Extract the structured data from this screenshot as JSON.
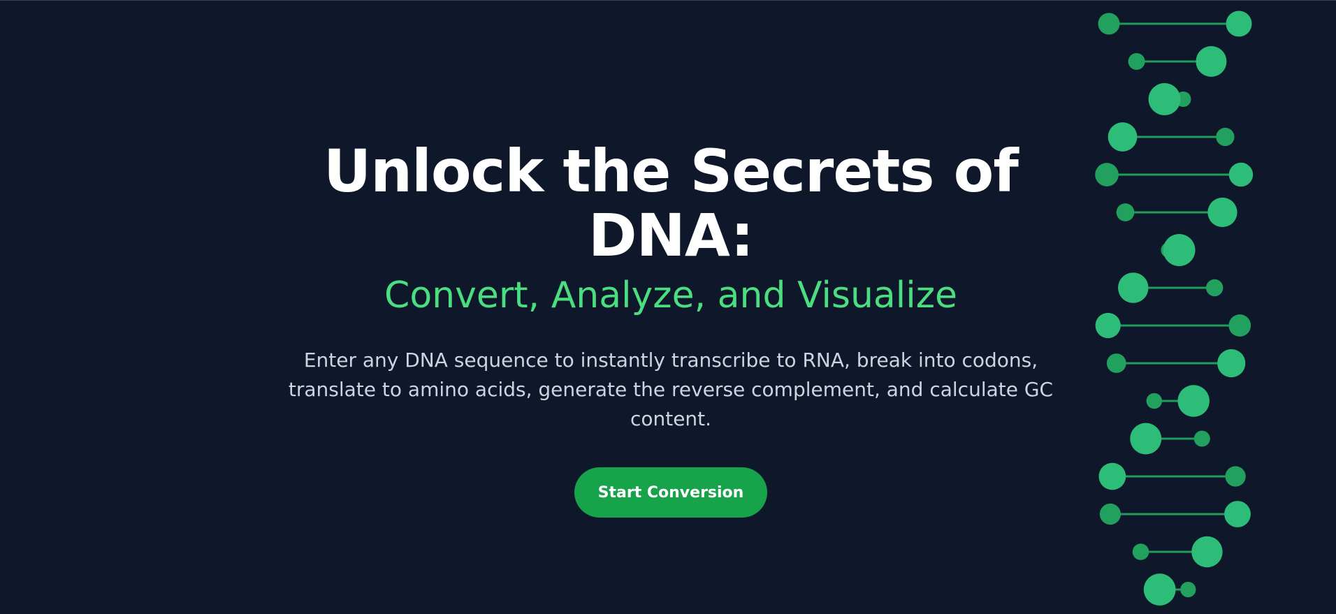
{
  "hero": {
    "headline": "Unlock the Secrets of DNA:",
    "subheadline": "Convert, Analyze, and Visualize",
    "description": "Enter any DNA sequence to instantly transcribe to RNA, break into codons, translate to amino acids, generate the reverse complement, and calculate GC content.",
    "cta_label": "Start Conversion"
  },
  "colors": {
    "background": "#0f172a",
    "headline": "#ffffff",
    "accent": "#4ade80",
    "description": "#cbd5e1",
    "button": "#16a34a",
    "helix_light": "#2ebd78",
    "helix_dark": "#22a05e",
    "helix_bond": "#1f9d5a"
  },
  "decoration": {
    "icon": "dna-helix-icon"
  }
}
